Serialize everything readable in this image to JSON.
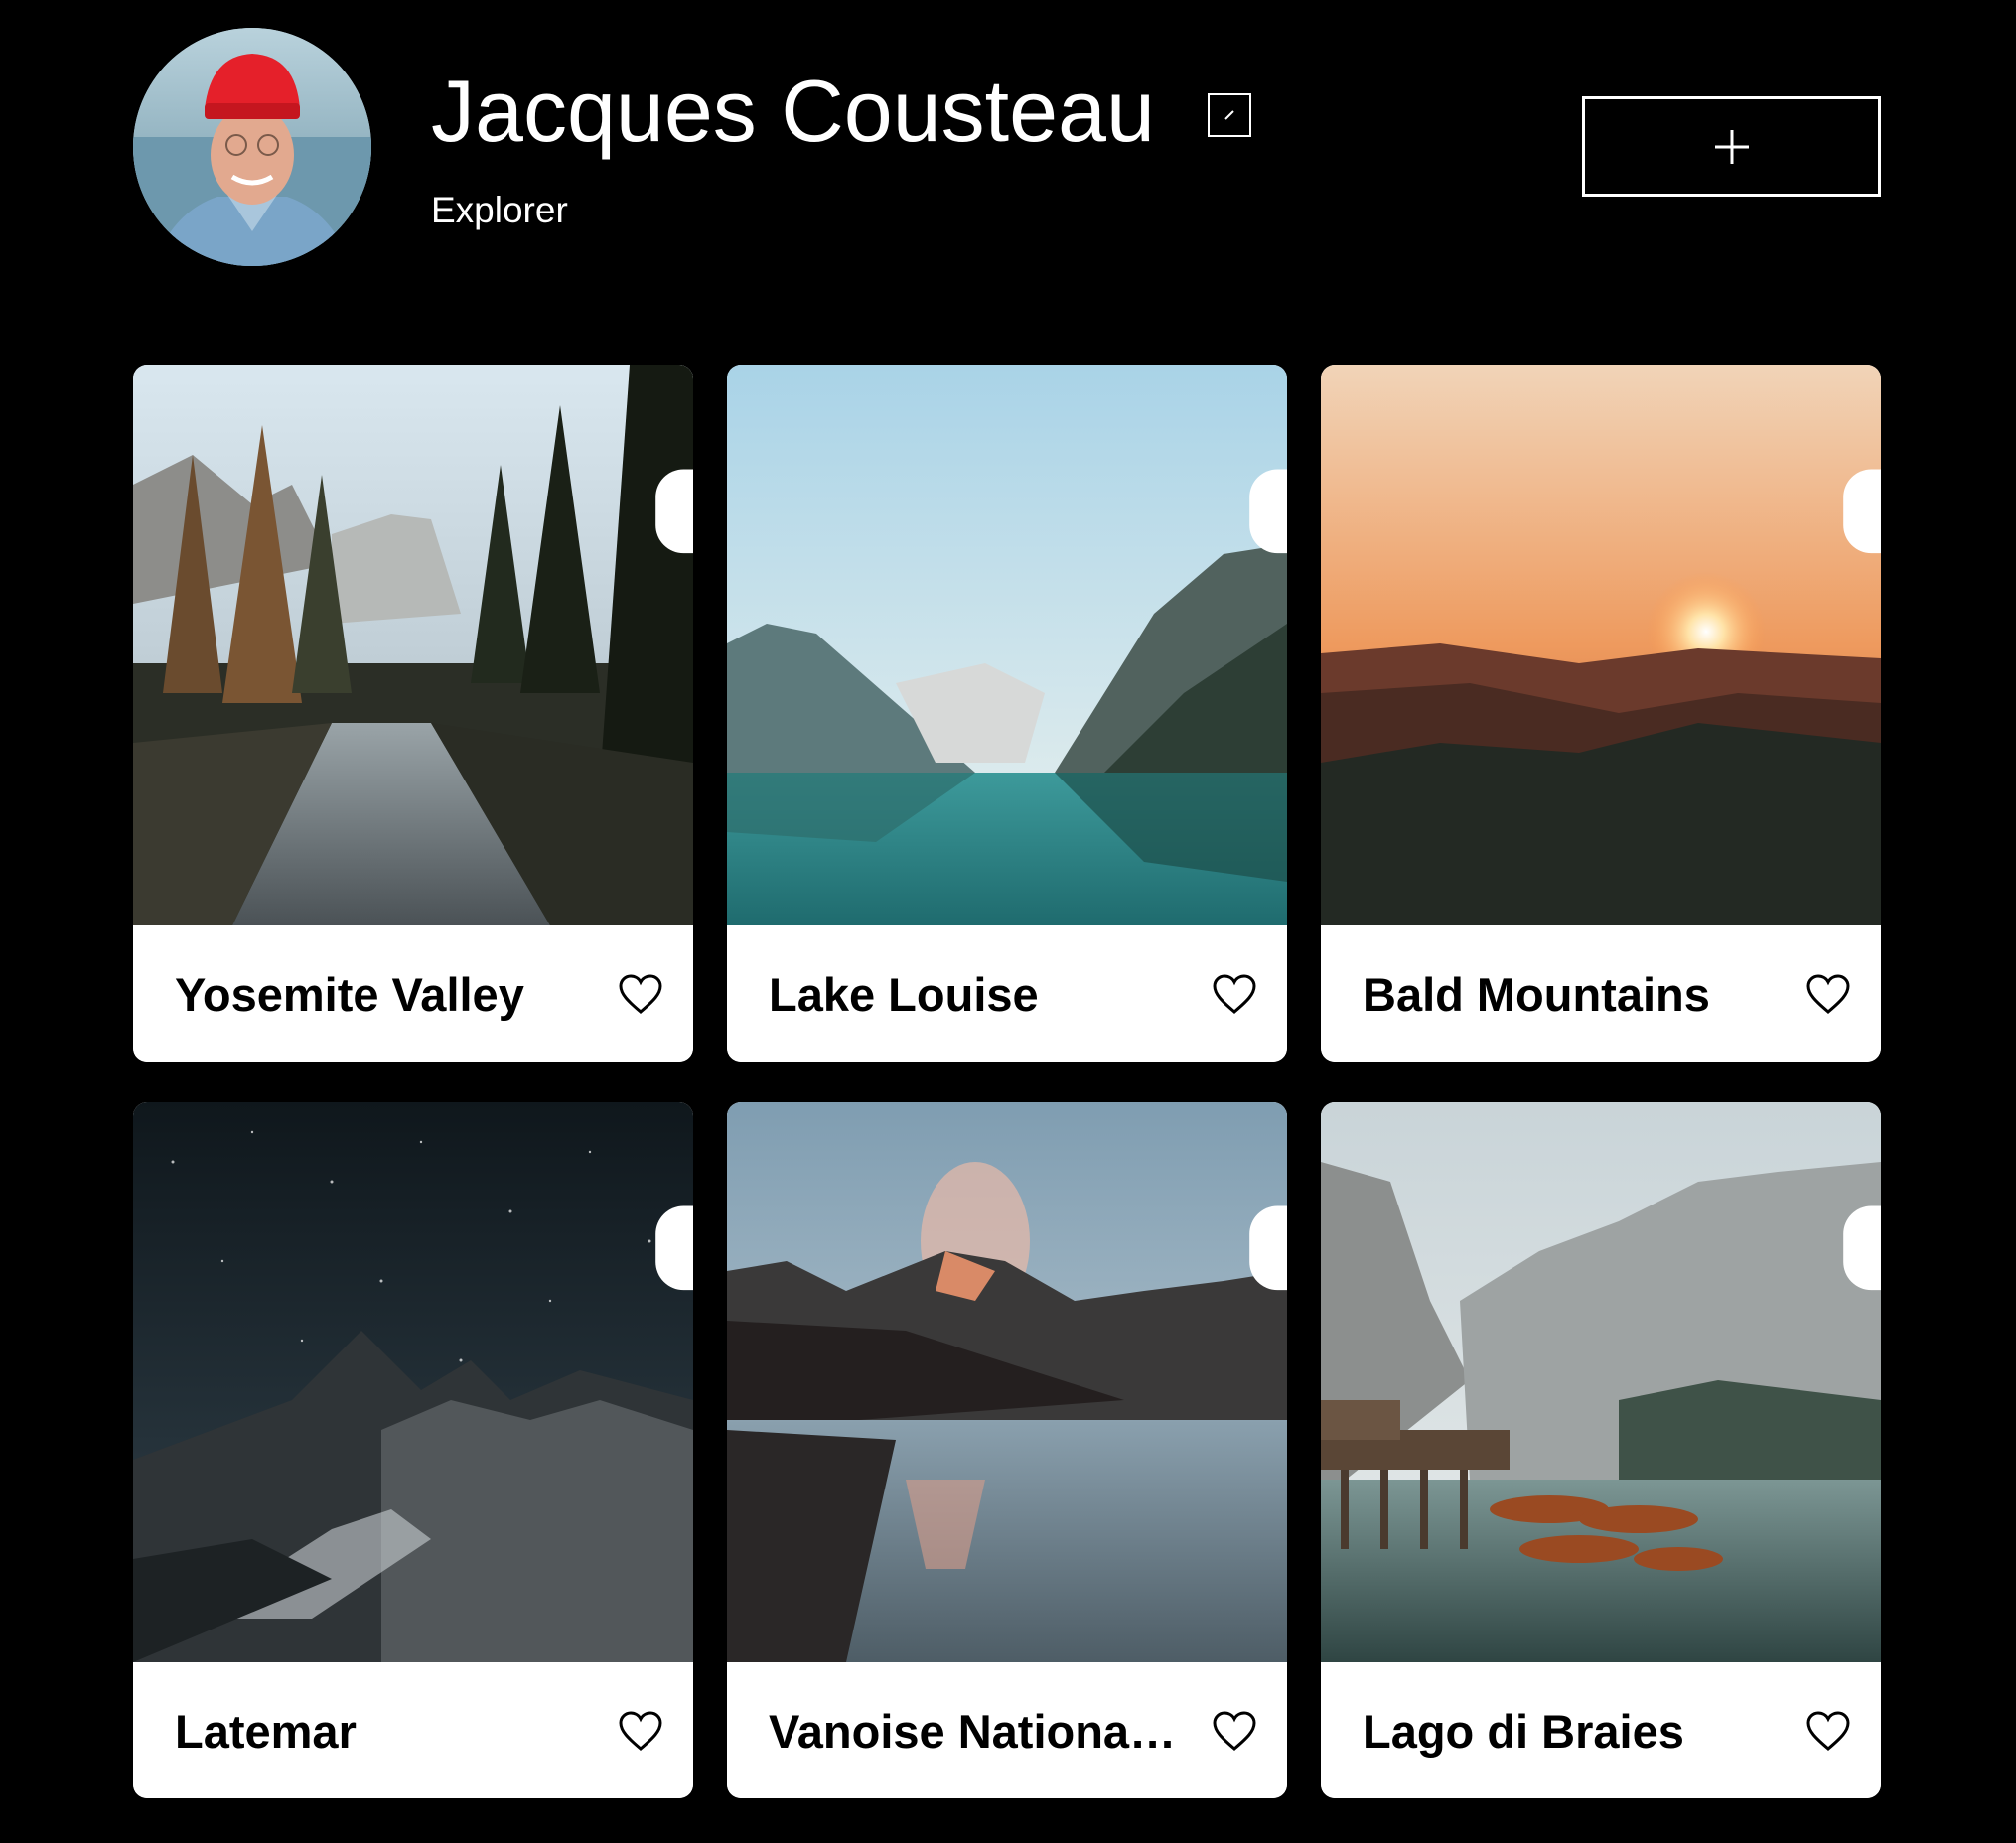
{
  "profile": {
    "name": "Jacques Cousteau",
    "description": "Explorer",
    "avatar_icon": "avatar-photo",
    "edit_icon": "pencil-icon",
    "add_icon": "plus-icon"
  },
  "cards": [
    {
      "title": "Yosemite Valley",
      "scene": "forest-river",
      "liked": false
    },
    {
      "title": "Lake Louise",
      "scene": "mountain-lake",
      "liked": false
    },
    {
      "title": "Bald Mountains",
      "scene": "sunset-mountains",
      "liked": false
    },
    {
      "title": "Latemar",
      "scene": "night-mountains",
      "liked": false
    },
    {
      "title": "Vanoise National Park",
      "scene": "reflection-lake",
      "liked": false
    },
    {
      "title": "Lago di Braies",
      "scene": "dock-boats",
      "liked": false
    }
  ],
  "icons": {
    "delete": "trash-icon",
    "like": "heart-icon"
  },
  "colors": {
    "background": "#000000",
    "card_bg": "#ffffff",
    "text_light": "#ffffff",
    "text_dark": "#000000"
  }
}
